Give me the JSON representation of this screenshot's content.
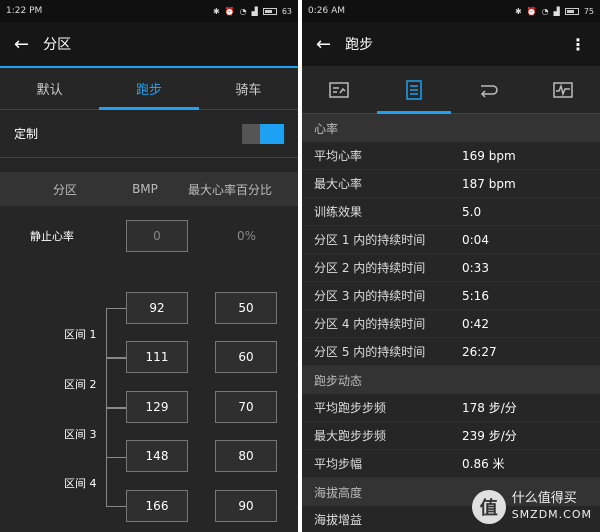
{
  "left": {
    "status": {
      "time": "1:22 PM",
      "battery": "63"
    },
    "appbar": {
      "title": "分区"
    },
    "tabs": [
      {
        "label": "默认"
      },
      {
        "label": "跑步"
      },
      {
        "label": "骑车"
      }
    ],
    "custom": {
      "label": "定制",
      "toggle_on": true
    },
    "zone_table": {
      "headers": [
        "分区",
        "BMP",
        "最大心率百分比"
      ],
      "rest": {
        "label": "静止心率",
        "bpm": "0",
        "percent": "0%"
      },
      "zones": [
        {
          "label": "区间 1",
          "low": "92",
          "high": "111",
          "low_pct": "50",
          "high_pct": "60"
        },
        {
          "label": "区间 2"
        },
        {
          "label": "区间 3",
          "low": "129",
          "high": "148",
          "low_pct": "70",
          "high_pct": "80"
        },
        {
          "label": "区间 4",
          "low": "166",
          "low_pct": "90"
        }
      ]
    }
  },
  "right": {
    "status": {
      "time": "0:26 AM",
      "battery": "75"
    },
    "appbar": {
      "title": "跑步"
    },
    "icon_tabs": [
      "summary-icon",
      "details-icon",
      "laps-icon",
      "chart-icon"
    ],
    "sections": [
      {
        "title": "心率",
        "rows": [
          {
            "k": "平均心率",
            "v": "169 bpm"
          },
          {
            "k": "最大心率",
            "v": "187 bpm"
          },
          {
            "k": "训练效果",
            "v": "5.0"
          },
          {
            "k": "分区 1 内的持续时间",
            "v": "0:04"
          },
          {
            "k": "分区 2 内的持续时间",
            "v": "0:33"
          },
          {
            "k": "分区 3 内的持续时间",
            "v": "5:16"
          },
          {
            "k": "分区 4 内的持续时间",
            "v": "0:42"
          },
          {
            "k": "分区 5 内的持续时间",
            "v": "26:27"
          }
        ]
      },
      {
        "title": "跑步动态",
        "rows": [
          {
            "k": "平均跑步步频",
            "v": "178 步/分"
          },
          {
            "k": "最大跑步步频",
            "v": "239 步/分"
          },
          {
            "k": "平均步幅",
            "v": "0.86 米"
          }
        ]
      },
      {
        "title": "海拔高度",
        "rows": [
          {
            "k": "海拔增益",
            "v": ""
          }
        ]
      }
    ],
    "watermark": {
      "logo": "值",
      "line1": "什么值得买",
      "line2": "SMZDM.COM"
    }
  },
  "colors": {
    "accent": "#1da1f2",
    "background": "#262626"
  }
}
